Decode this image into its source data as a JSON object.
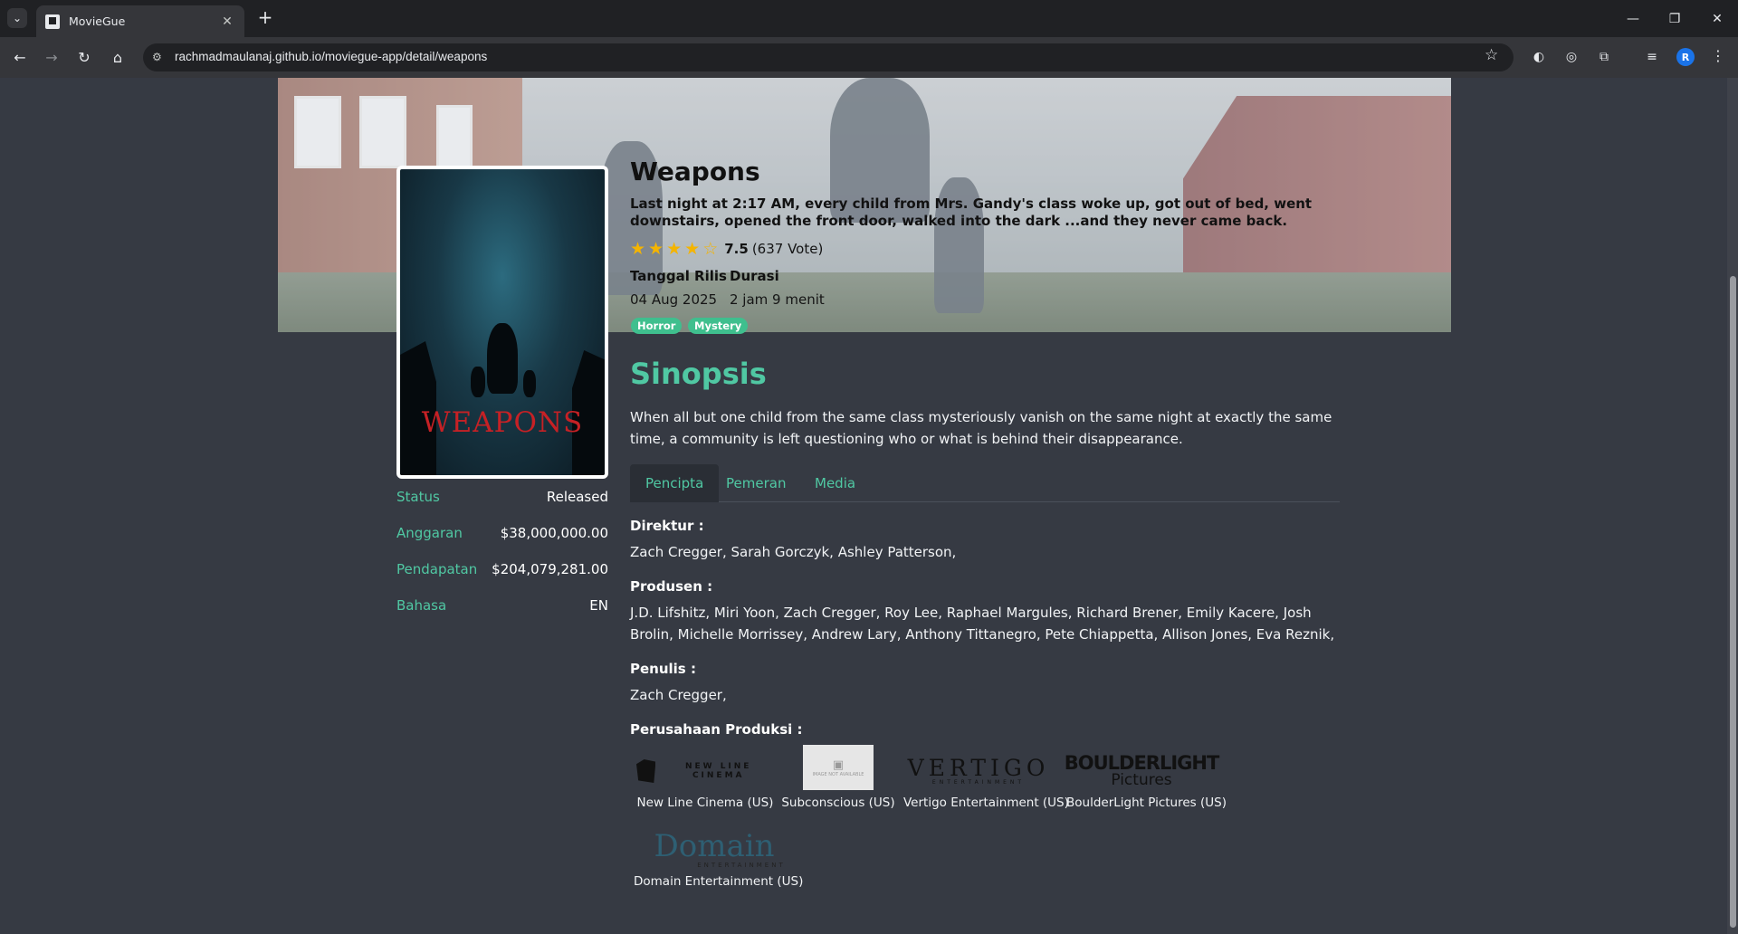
{
  "browser": {
    "tab_title": "MovieGue",
    "url": "rachmadmaulanaj.github.io/moviegue-app/detail/weapons",
    "avatar_letter": "R"
  },
  "movie": {
    "title": "Weapons",
    "tagline": "Last night at 2:17 AM, every child from Mrs. Gandy's class woke up, got out of bed, went downstairs, opened the front door, walked into the dark ...and they never came back.",
    "rating": {
      "stars_filled": 4,
      "stars_total": 5,
      "score": "7.5",
      "votes": "(637 Vote)"
    },
    "poster_title": "WEAPONS",
    "release_label": "Tanggal Rilis",
    "release_value": "04 Aug 2025",
    "duration_label": "Durasi",
    "duration_value": "2 jam 9 menit",
    "genres": [
      "Horror",
      "Mystery"
    ]
  },
  "facts": [
    {
      "label": "Status",
      "value": "Released"
    },
    {
      "label": "Anggaran",
      "value": "$38,000,000.00"
    },
    {
      "label": "Pendapatan",
      "value": "$204,079,281.00"
    },
    {
      "label": "Bahasa",
      "value": "EN"
    }
  ],
  "synopsis": {
    "heading": "Sinopsis",
    "text": "When all but one child from the same class mysteriously vanish on the same night at exactly the same time, a community is left questioning who or what is behind their disappearance."
  },
  "tabs": [
    "Pencipta",
    "Pemeran",
    "Media"
  ],
  "crew": {
    "director_label": "Direktur :",
    "director": "Zach Cregger, Sarah Gorczyk, Ashley Patterson,",
    "producer_label": "Produsen :",
    "producer": "J.D. Lifshitz, Miri Yoon, Zach Cregger, Roy Lee, Raphael Margules, Richard Brener, Emily Kacere, Josh Brolin, Michelle Morrissey, Andrew Lary, Anthony Tittanegro, Pete Chiappetta, Allison Jones, Eva Reznik,",
    "writer_label": "Penulis :",
    "writer": "Zach Cregger,",
    "companies_label": "Perusahaan Produksi :"
  },
  "companies": [
    {
      "name": "New Line Cinema (US)",
      "logo_text": "NEW LINE CINEMA"
    },
    {
      "name": "Subconscious (US)",
      "logo_text": "IMAGE NOT AVAILABLE"
    },
    {
      "name": "Vertigo Entertainment (US)",
      "logo_text": "VERTIGO",
      "logo_sub": "ENTERTAINMENT"
    },
    {
      "name": "BoulderLight Pictures (US)",
      "logo_text": "BOULDERLIGHT",
      "logo_sub": "Pictures"
    },
    {
      "name": "Domain Entertainment (US)",
      "logo_text": "Domain",
      "logo_sub": "ENTERTAINMENT"
    }
  ],
  "colors": {
    "accent": "#50c8a3",
    "star": "#f4b400",
    "page_bg": "#363a43"
  }
}
